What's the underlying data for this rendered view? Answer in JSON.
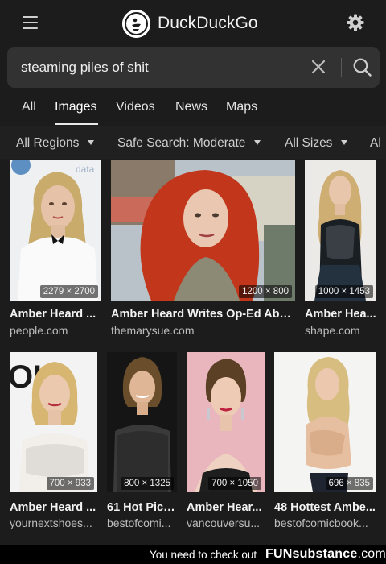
{
  "brand": {
    "name": "DuckDuckGo"
  },
  "search": {
    "query": "steaming piles of shit"
  },
  "tabs": [
    {
      "label": "All"
    },
    {
      "label": "Images"
    },
    {
      "label": "Videos"
    },
    {
      "label": "News"
    },
    {
      "label": "Maps"
    }
  ],
  "filters": [
    {
      "label": "All Regions"
    },
    {
      "label": "Safe Search: Moderate"
    },
    {
      "label": "All Sizes"
    },
    {
      "label": "Al"
    }
  ],
  "results": [
    {
      "title": "Amber Heard ...",
      "source": "people.com",
      "dims": "2279 × 2700"
    },
    {
      "title": "Amber Heard Writes Op-Ed Abo...",
      "source": "themarysue.com",
      "dims": "1200 × 800"
    },
    {
      "title": "Amber Hea...",
      "source": "shape.com",
      "dims": "1000 × 1453"
    },
    {
      "title": "Amber Heard ...",
      "source": "yournextshoes...",
      "dims": "700 × 933"
    },
    {
      "title": "61 Hot Pict...",
      "source": "bestofcomi...",
      "dims": "800 × 1325"
    },
    {
      "title": "Amber Hear...",
      "source": "vancouversu...",
      "dims": "700 × 1050"
    },
    {
      "title": "48 Hottest Ambe...",
      "source": "bestofcomicbook...",
      "dims": "696 × 835"
    }
  ],
  "footer": {
    "text": "You need to check out",
    "brand": "FUNsubstance",
    "domain": ".com"
  },
  "colors": {
    "background": "#1c1c1c",
    "search_bg": "#323232",
    "text": "#eeeeee"
  }
}
